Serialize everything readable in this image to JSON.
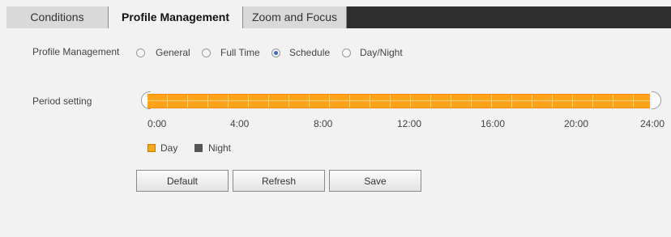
{
  "tabs": [
    {
      "label": "Conditions"
    },
    {
      "label": "Profile Management"
    },
    {
      "label": "Zoom and Focus"
    }
  ],
  "form": {
    "profile_label": "Profile Management",
    "options": [
      {
        "label": "General",
        "checked": false
      },
      {
        "label": "Full Time",
        "checked": false
      },
      {
        "label": "Schedule",
        "checked": true
      },
      {
        "label": "Day/Night",
        "checked": false
      }
    ],
    "period_label": "Period setting",
    "ticks": [
      "0:00",
      "4:00",
      "8:00",
      "12:00",
      "16:00",
      "20:00",
      "24:00"
    ],
    "legend": [
      {
        "label": "Day",
        "color": "#f5a623"
      },
      {
        "label": "Night",
        "color": "#555555"
      }
    ],
    "schedule": {
      "day_start": "0:00",
      "day_end": "24:00"
    }
  },
  "buttons": {
    "default": "Default",
    "refresh": "Refresh",
    "save": "Save"
  },
  "colors": {
    "day": "#ffa41a",
    "tabbar": "#2d2d2d"
  }
}
